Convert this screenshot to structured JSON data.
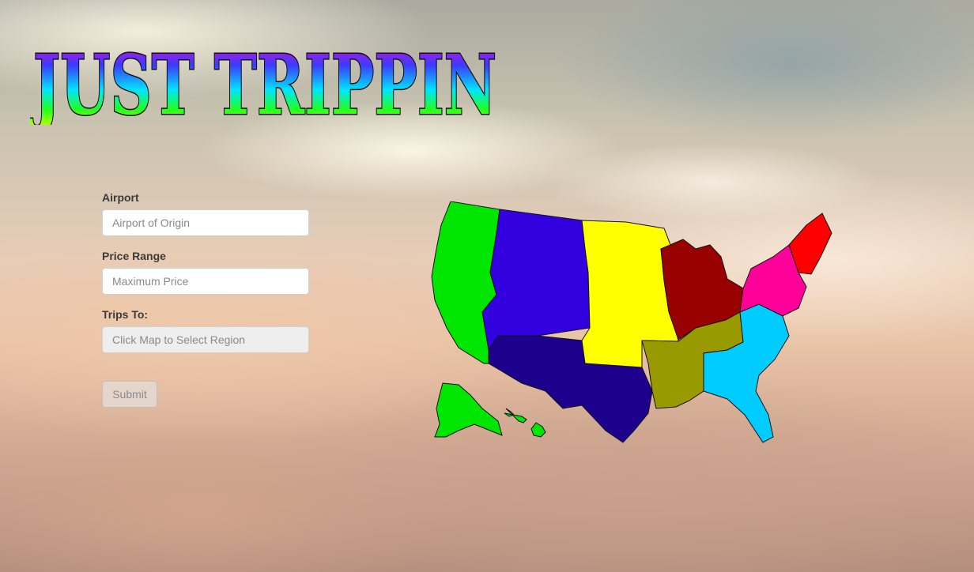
{
  "app": {
    "logo_text": "JUST TRIPPIN"
  },
  "form": {
    "airport_label": "Airport",
    "airport_placeholder": "Airport of Origin",
    "price_label": "Price Range",
    "price_placeholder": "Maximum Price",
    "trips_label": "Trips To:",
    "trips_placeholder": "Click Map to Select Region",
    "submit_label": "Submit"
  },
  "map": {
    "regions": [
      {
        "name": "west-coast",
        "color": "#00e600"
      },
      {
        "name": "mountain-north",
        "color": "#3300e0"
      },
      {
        "name": "southwest",
        "color": "#1d008c"
      },
      {
        "name": "plains",
        "color": "#ffff00"
      },
      {
        "name": "midwest-east",
        "color": "#990000"
      },
      {
        "name": "south-central",
        "color": "#999900"
      },
      {
        "name": "southeast",
        "color": "#00ccff"
      },
      {
        "name": "mid-atlantic",
        "color": "#ff0099"
      },
      {
        "name": "new-england",
        "color": "#ff0000"
      }
    ]
  }
}
